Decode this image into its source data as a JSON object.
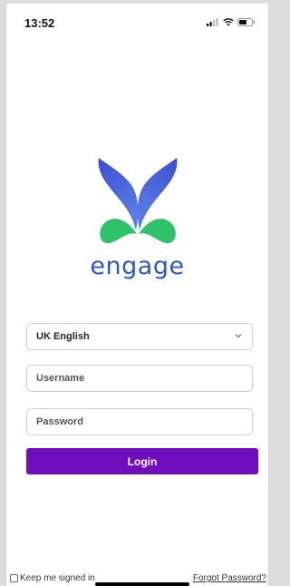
{
  "status_bar": {
    "time": "13:52",
    "icons": [
      "signal-icon",
      "wifi-icon",
      "battery-icon"
    ]
  },
  "brand": {
    "name": "engage",
    "colors": {
      "blue": "#2f57c6",
      "green": "#2ec26b",
      "purple": "#6f0dbf"
    }
  },
  "form": {
    "language": "UK English",
    "username_placeholder": "Username",
    "password_placeholder": "Password",
    "login_label": "Login"
  },
  "footer": {
    "keep_signed_in": "Keep me signed in",
    "forgot_password": "Forgot Password?"
  }
}
